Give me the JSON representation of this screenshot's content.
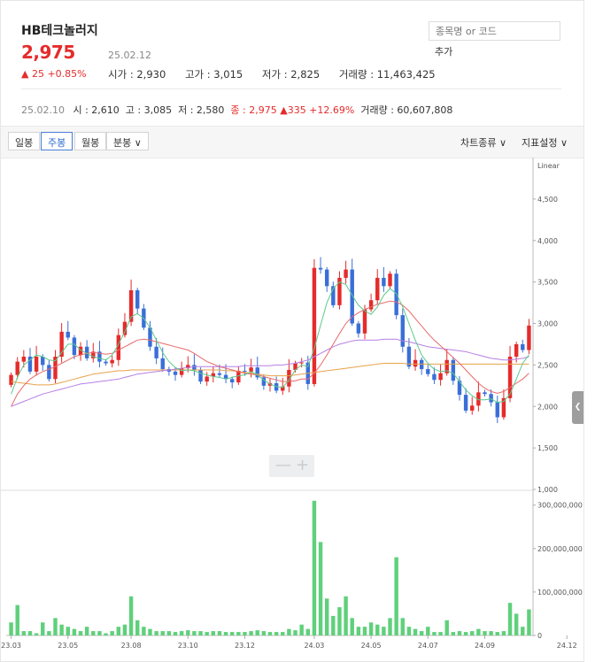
{
  "stock": {
    "name": "HB테크놀러지",
    "price": "2,975",
    "date": "25.02.12",
    "change": "▲ 25 +0.85%",
    "open": "시가 : 2,930",
    "high": "고가 : 3,015",
    "low": "저가 : 2,825",
    "volume": "거래량 : 11,463,425"
  },
  "search": {
    "placeholder": "종목명 or 코드",
    "add_label": "추가"
  },
  "previous": {
    "date": "25.02.10",
    "open": "시 : 2,610",
    "high": "고 : 3,085",
    "low": "저 : 2,580",
    "close": "종 : 2,975",
    "change": "▲335 +12.69%",
    "volume": "거래량 : 60,607,808"
  },
  "toolbar": {
    "daily": "일봉",
    "weekly": "주봉",
    "monthly": "월봉",
    "minute": "분봉 ∨",
    "chart_type": "차트종류 ∨",
    "indicator": "지표설정 ∨"
  },
  "colors": {
    "up": "#e52b2b",
    "down": "#3a6fd8",
    "volume": "#5fd07b",
    "ma5": "#5cc98c",
    "ma20": "#e86a6a",
    "ma60": "#b77fe3",
    "ma120": "#e8a24a"
  },
  "chart_data": {
    "type": "candlestick",
    "scale_label": "Linear",
    "price_ylim": [
      1000,
      5000
    ],
    "price_ticks": [
      1000,
      1500,
      2000,
      2500,
      3000,
      3500,
      4000,
      4500
    ],
    "price_tick_labels": [
      "1,000",
      "1,500",
      "2,000",
      "2,500",
      "3,000",
      "3,500",
      "4,000",
      "4,500"
    ],
    "volume_ylim": [
      0,
      330000000
    ],
    "volume_ticks": [
      0,
      100000000,
      200000000,
      300000000
    ],
    "volume_tick_labels": [
      "0",
      "100,000,000",
      "200,000,000",
      "300,000,000"
    ],
    "x_tick_labels": [
      "23.03",
      "23.05",
      "23.08",
      "23.10",
      "23.12",
      "24.03",
      "24.05",
      "24.07",
      "24.09",
      "24.12"
    ],
    "x_tick_index": [
      0,
      9,
      19,
      28,
      37,
      48,
      57,
      66,
      75,
      88
    ],
    "closes": [
      2380,
      2540,
      2600,
      2420,
      2600,
      2500,
      2330,
      2600,
      2900,
      2830,
      2620,
      2720,
      2580,
      2660,
      2540,
      2520,
      2560,
      2860,
      3020,
      3400,
      3180,
      2950,
      2720,
      2580,
      2450,
      2420,
      2380,
      2460,
      2500,
      2440,
      2300,
      2360,
      2400,
      2380,
      2330,
      2290,
      2430,
      2420,
      2470,
      2350,
      2250,
      2280,
      2190,
      2240,
      2440,
      2520,
      2530,
      2270,
      3670,
      3650,
      3450,
      3220,
      3550,
      3650,
      3000,
      2880,
      3170,
      3280,
      3550,
      3450,
      3600,
      3100,
      2720,
      2480,
      2560,
      2450,
      2390,
      2320,
      2400,
      2560,
      2310,
      2140,
      1950,
      2010,
      2170,
      2150,
      2050,
      1870,
      2100,
      2600,
      2750,
      2680,
      2975
    ],
    "ma5": [
      2150,
      2350,
      2500,
      2560,
      2620,
      2600,
      2560,
      2550,
      2650,
      2750,
      2750,
      2680,
      2640,
      2600,
      2580,
      2560,
      2620,
      2750,
      2900,
      3080,
      3120,
      3060,
      2950,
      2800,
      2650,
      2540,
      2470,
      2430,
      2440,
      2430,
      2400,
      2380,
      2360,
      2350,
      2330,
      2350,
      2370,
      2380,
      2420,
      2380,
      2320,
      2270,
      2240,
      2230,
      2320,
      2440,
      2500,
      2480,
      2700,
      2980,
      3250,
      3420,
      3500,
      3470,
      3340,
      3220,
      3150,
      3110,
      3200,
      3340,
      3420,
      3360,
      3200,
      3000,
      2800,
      2620,
      2520,
      2450,
      2420,
      2430,
      2400,
      2300,
      2200,
      2130,
      2080,
      2080,
      2090,
      2050,
      2060,
      2150,
      2330,
      2520,
      2620
    ],
    "ma20": [
      2000,
      2150,
      2250,
      2330,
      2380,
      2420,
      2450,
      2480,
      2520,
      2560,
      2600,
      2620,
      2640,
      2650,
      2640,
      2630,
      2640,
      2680,
      2720,
      2760,
      2800,
      2810,
      2800,
      2780,
      2760,
      2740,
      2720,
      2700,
      2680,
      2640,
      2590,
      2540,
      2510,
      2480,
      2460,
      2440,
      2420,
      2400,
      2390,
      2380,
      2360,
      2340,
      2320,
      2300,
      2300,
      2310,
      2330,
      2330,
      2400,
      2500,
      2620,
      2750,
      2880,
      3000,
      3080,
      3130,
      3170,
      3200,
      3230,
      3250,
      3270,
      3260,
      3220,
      3150,
      3060,
      2970,
      2880,
      2800,
      2730,
      2660,
      2590,
      2520,
      2440,
      2360,
      2280,
      2220,
      2180,
      2160,
      2180,
      2230,
      2280,
      2330,
      2400
    ],
    "ma60": [
      2000,
      2030,
      2060,
      2090,
      2120,
      2150,
      2170,
      2190,
      2210,
      2230,
      2250,
      2270,
      2280,
      2290,
      2300,
      2310,
      2320,
      2330,
      2350,
      2370,
      2390,
      2400,
      2410,
      2420,
      2430,
      2440,
      2450,
      2460,
      2470,
      2480,
      2480,
      2480,
      2480,
      2480,
      2480,
      2480,
      2480,
      2490,
      2490,
      2490,
      2490,
      2490,
      2500,
      2500,
      2510,
      2520,
      2540,
      2560,
      2600,
      2640,
      2680,
      2720,
      2750,
      2770,
      2790,
      2800,
      2800,
      2800,
      2800,
      2810,
      2810,
      2810,
      2790,
      2780,
      2760,
      2740,
      2720,
      2710,
      2700,
      2690,
      2680,
      2670,
      2660,
      2640,
      2620,
      2600,
      2580,
      2570,
      2560,
      2560,
      2570,
      2580,
      2600
    ],
    "ma120": [
      2300,
      2290,
      2280,
      2270,
      2260,
      2260,
      2260,
      2270,
      2290,
      2310,
      2330,
      2350,
      2370,
      2390,
      2400,
      2410,
      2420,
      2430,
      2430,
      2440,
      2440,
      2440,
      2440,
      2440,
      2440,
      2440,
      2440,
      2440,
      2440,
      2440,
      2440,
      2440,
      2440,
      2440,
      2430,
      2430,
      2420,
      2410,
      2400,
      2390,
      2380,
      2370,
      2370,
      2370,
      2370,
      2380,
      2390,
      2400,
      2410,
      2420,
      2430,
      2440,
      2450,
      2460,
      2470,
      2480,
      2490,
      2500,
      2510,
      2520,
      2520,
      2520,
      2520,
      2510,
      2510,
      2510,
      2510,
      2510,
      2510,
      2510,
      2510,
      2510,
      2510,
      2510,
      2510,
      2510,
      2510,
      2510,
      2510,
      2510,
      2510,
      2510,
      2510
    ],
    "volume": [
      30000000,
      70000000,
      10000000,
      10000000,
      5000000,
      30000000,
      10000000,
      40000000,
      25000000,
      20000000,
      15000000,
      10000000,
      20000000,
      10000000,
      10000000,
      5000000,
      10000000,
      20000000,
      25000000,
      90000000,
      35000000,
      20000000,
      15000000,
      10000000,
      10000000,
      10000000,
      8000000,
      10000000,
      12000000,
      10000000,
      10000000,
      8000000,
      10000000,
      10000000,
      8000000,
      8000000,
      8000000,
      8000000,
      10000000,
      12000000,
      10000000,
      8000000,
      8000000,
      8000000,
      15000000,
      12000000,
      25000000,
      15000000,
      310000000,
      215000000,
      85000000,
      45000000,
      65000000,
      90000000,
      40000000,
      20000000,
      20000000,
      30000000,
      25000000,
      20000000,
      40000000,
      180000000,
      40000000,
      20000000,
      15000000,
      10000000,
      20000000,
      8000000,
      8000000,
      35000000,
      8000000,
      10000000,
      8000000,
      10000000,
      15000000,
      10000000,
      10000000,
      8000000,
      10000000,
      75000000,
      50000000,
      20000000,
      60000000
    ]
  }
}
